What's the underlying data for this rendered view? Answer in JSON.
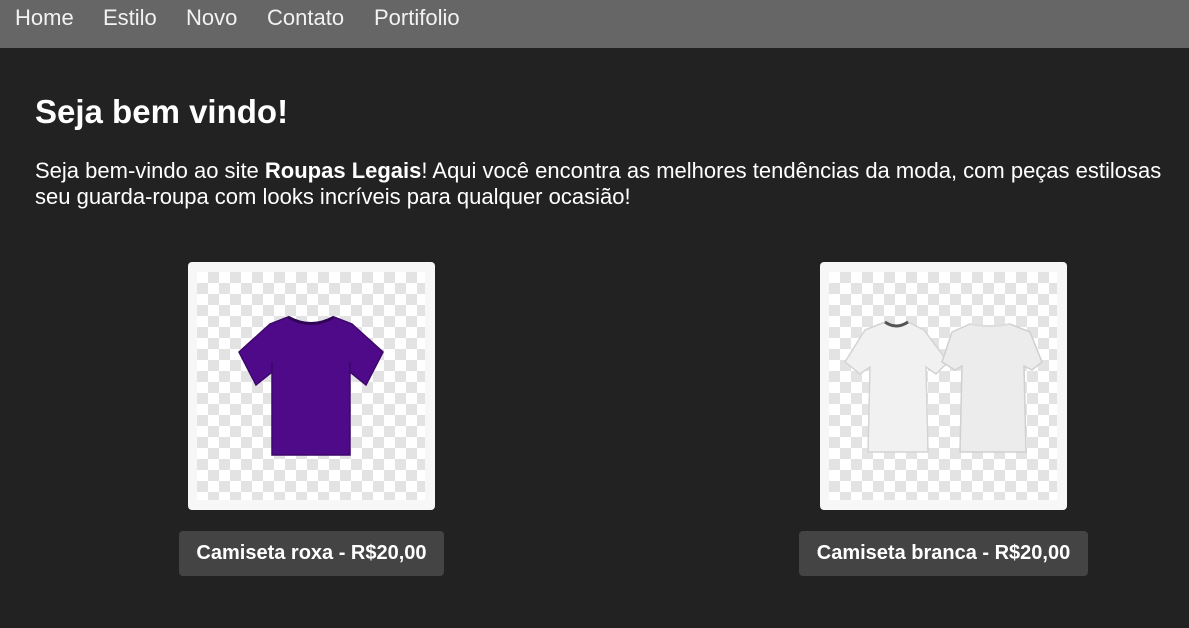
{
  "nav": {
    "items": [
      {
        "label": "Home"
      },
      {
        "label": "Estilo"
      },
      {
        "label": "Novo"
      },
      {
        "label": "Contato"
      },
      {
        "label": "Portifolio"
      }
    ]
  },
  "main": {
    "title": "Seja bem vindo!",
    "intro": {
      "prefix": "Seja bem-vindo ao site ",
      "brand": "Roupas Legais",
      "line1_rest": "! Aqui você encontra as melhores tendências da moda, com peças estilosas",
      "line2": "seu guarda-roupa com looks incríveis para qualquer ocasião!"
    }
  },
  "products": [
    {
      "label": "Camiseta roxa - R$20,00",
      "image": "purple-tshirt-image",
      "color": "#4f0a8a"
    },
    {
      "label": "Camiseta branca - R$20,00",
      "image": "white-tshirt-front-back-image",
      "color": "#ececec"
    }
  ],
  "colors": {
    "page_background": "#222222",
    "nav_background": "#666666",
    "label_background": "#444444"
  }
}
